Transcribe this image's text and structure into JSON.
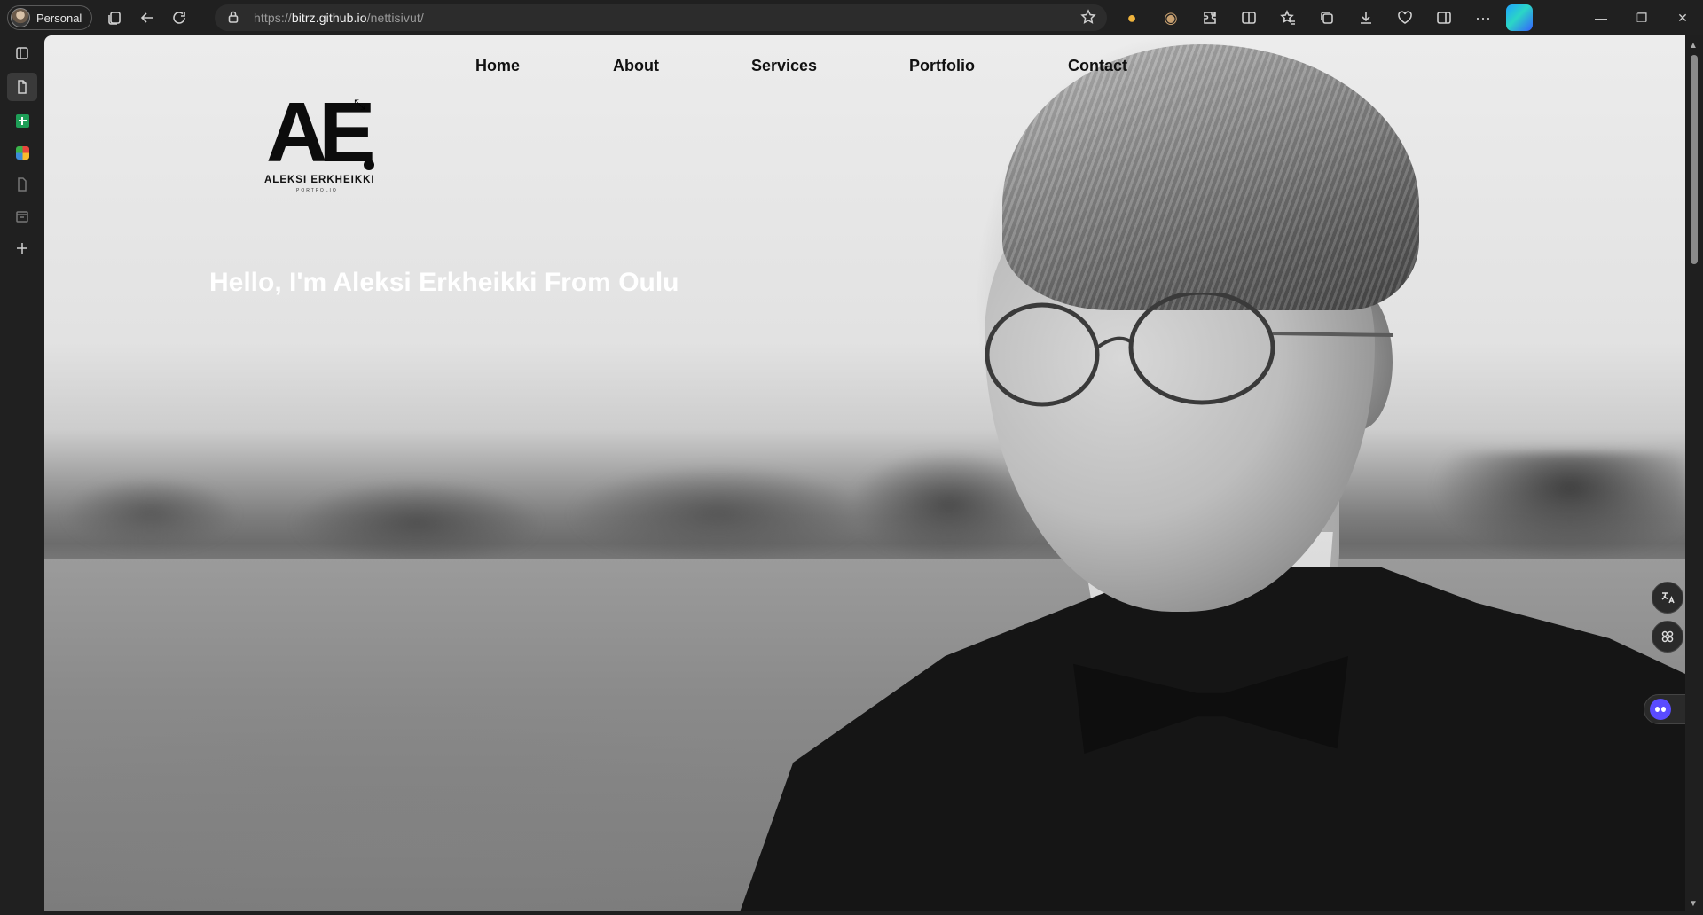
{
  "browser": {
    "profile_label": "Personal",
    "url_prefix": "https://",
    "url_host": "bitrz.github.io",
    "url_path": "/nettisivut/"
  },
  "site": {
    "nav": [
      {
        "label": "Home"
      },
      {
        "label": "About"
      },
      {
        "label": "Services"
      },
      {
        "label": "Portfolio"
      },
      {
        "label": "Contact"
      }
    ],
    "logo": {
      "mark": "AE",
      "name": "ALEKSI ERKHEIKKI",
      "sub": "PORTFOLIO"
    },
    "hero_title": "Hello, I'm Aleksi Erkheikki From Oulu"
  },
  "icons": {
    "titlebar": [
      "tab-actions-icon",
      "back-arrow-icon",
      "refresh-icon",
      "lock-icon",
      "favorite-star-icon"
    ],
    "toolbar": [
      "extension-bulb-icon",
      "extension-face-icon",
      "extensions-icon",
      "split-screen-icon",
      "favorites-icon",
      "collections-icon",
      "downloads-icon",
      "performance-icon",
      "sidebar-toggle-icon",
      "more-icon",
      "copilot-icon"
    ],
    "sidebar": [
      "vertical-tabs-icon",
      "page-icon",
      "sheets-icon",
      "apps-icon",
      "document-icon",
      "archive-icon",
      "add-icon"
    ],
    "floating": [
      "translate-icon",
      "apps-grid-icon",
      "assistant-bot-icon"
    ]
  },
  "colors": {
    "browser_chrome": "#202020",
    "hero_text": "#ffffff",
    "nav_text": "#111111"
  }
}
